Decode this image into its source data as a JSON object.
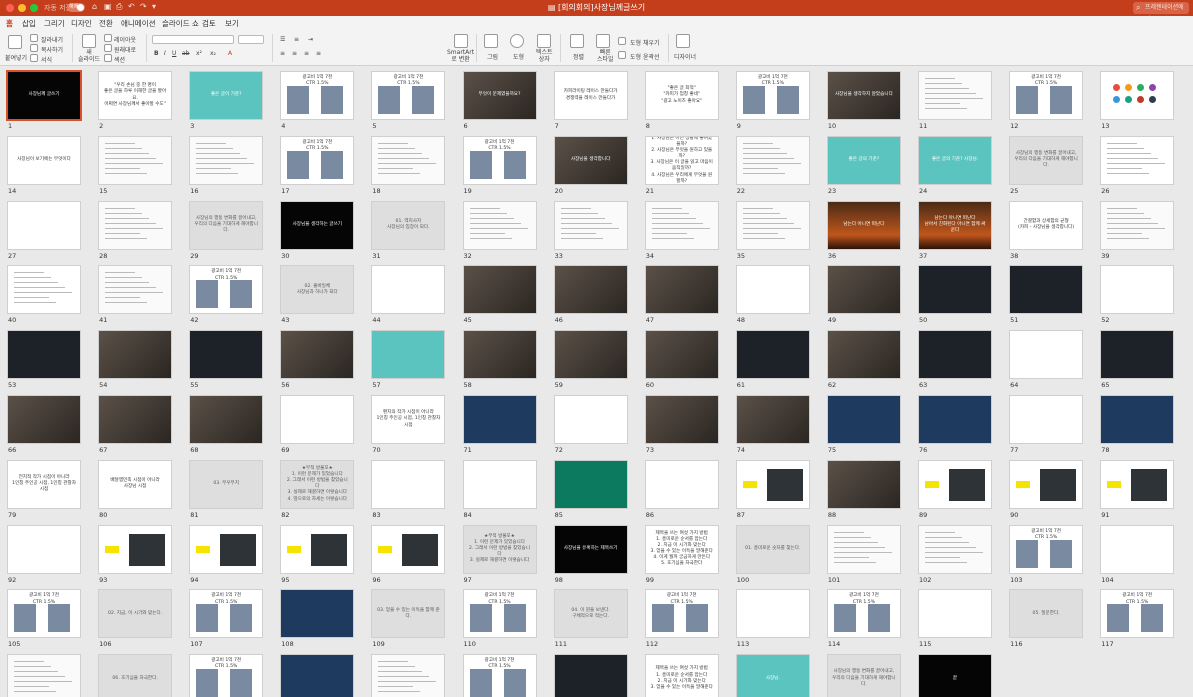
{
  "window": {
    "autosave_label": "자동 저장",
    "autosave_state": "해제",
    "title": "[회의회의]사장님께글쓰기",
    "search_placeholder": "프레젠테이션에서"
  },
  "tabs": [
    "홈",
    "삽입",
    "그리기",
    "디자인",
    "전환",
    "애니메이션",
    "슬라이드 쇼",
    "검토",
    "보기"
  ],
  "active_tab": "홈",
  "ribbon": {
    "paste": "붙여넣기",
    "cut": "잘라내기",
    "copy": "복사하기",
    "format": "서식",
    "new_slide": "새\n슬라이드",
    "layout": "레이아웃",
    "reset": "원래대로",
    "section": "섹션",
    "smartart": "SmartArt\n로 변환",
    "picture": "그림",
    "shape": "도형",
    "textbox": "텍스트\n상자",
    "arrange": "정렬",
    "quick_styles": "빠른\n스타일",
    "shape_fill": "도형 채우기",
    "shape_outline": "도형 윤곽선",
    "designer": "디자이너"
  },
  "colors": {
    "brand": "#c43e1c",
    "selection": "#d9502c",
    "teal": "#5cc4be"
  },
  "slides": [
    {
      "n": "1",
      "style": "black",
      "text": "사장님께 글쓰기",
      "selected": true
    },
    {
      "n": "2",
      "style": "white",
      "text": "\"우리 손님 중 한 명이\n좋은 글을 하루 이해한 글을 봤어요.\n어쩌면 사장님께서 좋아할 수도\""
    },
    {
      "n": "3",
      "style": "teal",
      "text": "좋은 글이 기준?"
    },
    {
      "n": "4",
      "style": "stats",
      "text": "광고비 1억 7천\nCTR 1.5%"
    },
    {
      "n": "5",
      "style": "stats",
      "text": "광고비 1억 7천\nCTR 1.5%"
    },
    {
      "n": "6",
      "style": "photo",
      "text": "무엇이 문제였을까요?"
    },
    {
      "n": "7",
      "style": "white",
      "text": "카피라이팅 레이스 만들다가\n경쟁력을 레이스 만들다가"
    },
    {
      "n": "8",
      "style": "white",
      "text": "\"좋은 글 최적\"\n\"카피가 엄청 좋네\"\n\"광고 노이즈 좋아요\""
    },
    {
      "n": "9",
      "style": "stats",
      "text": "광고비 1억 7천\nCTR 1.5%"
    },
    {
      "n": "10",
      "style": "photo",
      "text": "사장님을 생각하지 않았습니다"
    },
    {
      "n": "11",
      "style": "screen",
      "text": ""
    },
    {
      "n": "12",
      "style": "stats",
      "text": "광고비 1억 7천\nCTR 1.5%"
    },
    {
      "n": "13",
      "style": "icons",
      "text": ""
    },
    {
      "n": "14",
      "style": "white",
      "text": "사장님이 보기에는 무엇이다"
    },
    {
      "n": "15",
      "style": "screen",
      "text": ""
    },
    {
      "n": "16",
      "style": "screen",
      "text": ""
    },
    {
      "n": "17",
      "style": "stats",
      "text": "광고비 1억 7천\nCTR 1.5%"
    },
    {
      "n": "18",
      "style": "screen",
      "text": ""
    },
    {
      "n": "19",
      "style": "stats",
      "text": "광고비 1억 7천\nCTR 1.5%"
    },
    {
      "n": "20",
      "style": "photo",
      "text": "사장님을 생각합니다"
    },
    {
      "n": "21",
      "style": "white",
      "text": "1. 사장님은 어떤 상황에 놓여있을까?\n2. 사장님은 무엇을 원하고 있을까?\n3. 사장님은 이 글을 읽고 마음이 움직일까?\n4. 사장님은 우리에게 무엇을 원할까?"
    },
    {
      "n": "22",
      "style": "screen",
      "text": ""
    },
    {
      "n": "23",
      "style": "teal",
      "text": "좋은 글의 기준?"
    },
    {
      "n": "24",
      "style": "teal",
      "text": "좋은 글의 기준? 사장님."
    },
    {
      "n": "25",
      "style": "gray",
      "text": "사장님의 행동 변화를 끌어내고,\n우리의 다음을 기대하게 해야합니다."
    },
    {
      "n": "26",
      "style": "table",
      "text": ""
    },
    {
      "n": "27",
      "style": "white",
      "text": ""
    },
    {
      "n": "28",
      "style": "screen",
      "text": ""
    },
    {
      "n": "29",
      "style": "gray",
      "text": "사장님의 행동 변화를 끌어내고,\n우리의 다음을 기대하게 해야합니다."
    },
    {
      "n": "30",
      "style": "black",
      "text": "사장님을 생각하는 글쓰기"
    },
    {
      "n": "31",
      "style": "gray",
      "text": "01. 역지사지\n사장님의 입장이 되다."
    },
    {
      "n": "32",
      "style": "screen",
      "text": ""
    },
    {
      "n": "33",
      "style": "screen",
      "text": ""
    },
    {
      "n": "34",
      "style": "screen",
      "text": ""
    },
    {
      "n": "35",
      "style": "screen",
      "text": ""
    },
    {
      "n": "36",
      "style": "fire",
      "text": "남는다 아니면 떠난다"
    },
    {
      "n": "37",
      "style": "fire",
      "text": "남는다 아니면 떠난다\n남아서 친화된다 아니면 함께 싸운다"
    },
    {
      "n": "38",
      "style": "white",
      "text": "간결함과 상세함의 균형\n(카피 - 사장님을 생각합니다)"
    },
    {
      "n": "39",
      "style": "screen",
      "text": ""
    },
    {
      "n": "40",
      "style": "cols",
      "text": ""
    },
    {
      "n": "41",
      "style": "screen",
      "text": ""
    },
    {
      "n": "42",
      "style": "stats",
      "text": "광고비 1억 7천\nCTR 1.5%"
    },
    {
      "n": "43",
      "style": "gray",
      "text": "02. 몰바일체\n사장님과 하나가 되다"
    },
    {
      "n": "44",
      "style": "white",
      "text": ""
    },
    {
      "n": "45",
      "style": "photo",
      "text": ""
    },
    {
      "n": "46",
      "style": "photo",
      "text": ""
    },
    {
      "n": "47",
      "style": "photo",
      "text": ""
    },
    {
      "n": "48",
      "style": "white",
      "text": ""
    },
    {
      "n": "49",
      "style": "photo",
      "text": ""
    },
    {
      "n": "50",
      "style": "dark",
      "text": ""
    },
    {
      "n": "51",
      "style": "dark",
      "text": ""
    },
    {
      "n": "52",
      "style": "white",
      "text": ""
    },
    {
      "n": "53",
      "style": "dark",
      "text": ""
    },
    {
      "n": "54",
      "style": "photo",
      "text": ""
    },
    {
      "n": "55",
      "style": "dark",
      "text": ""
    },
    {
      "n": "56",
      "style": "photo",
      "text": ""
    },
    {
      "n": "57",
      "style": "teal",
      "text": ""
    },
    {
      "n": "58",
      "style": "photo",
      "text": ""
    },
    {
      "n": "59",
      "style": "photo",
      "text": ""
    },
    {
      "n": "60",
      "style": "photo",
      "text": ""
    },
    {
      "n": "61",
      "style": "dark",
      "text": ""
    },
    {
      "n": "62",
      "style": "photo",
      "text": ""
    },
    {
      "n": "63",
      "style": "dark",
      "text": ""
    },
    {
      "n": "64",
      "style": "white",
      "text": ""
    },
    {
      "n": "65",
      "style": "dark",
      "text": ""
    },
    {
      "n": "66",
      "style": "photo",
      "text": ""
    },
    {
      "n": "67",
      "style": "photo",
      "text": ""
    },
    {
      "n": "68",
      "style": "photo",
      "text": ""
    },
    {
      "n": "69",
      "style": "white",
      "text": ""
    },
    {
      "n": "70",
      "style": "white",
      "text": "편지의 작가 시점이 아니라\n1인칭 주인공 시점, 1인칭 관찰자 시점"
    },
    {
      "n": "71",
      "style": "navy",
      "text": ""
    },
    {
      "n": "72",
      "style": "white",
      "text": ""
    },
    {
      "n": "73",
      "style": "photo",
      "text": ""
    },
    {
      "n": "74",
      "style": "photo",
      "text": ""
    },
    {
      "n": "75",
      "style": "navy",
      "text": ""
    },
    {
      "n": "76",
      "style": "navy",
      "text": ""
    },
    {
      "n": "77",
      "style": "white",
      "text": ""
    },
    {
      "n": "78",
      "style": "navy",
      "text": ""
    },
    {
      "n": "79",
      "style": "white",
      "text": "전지적 작가 시점이 아니라\n1인칭 주인공 시점, 1인칭 관찰자 시점"
    },
    {
      "n": "80",
      "style": "white",
      "text": "배달앱민족 시점이 아니라\n사장님 시점"
    },
    {
      "n": "81",
      "style": "gray",
      "text": "03. 무우무치"
    },
    {
      "n": "82",
      "style": "gray",
      "text": "★무적 방울모★\n1. 이런 문제가 있었습니다\n2. 그래서 이런 방법을 찾았습니다\n3. 실제로 해결하면 이렇습니다\n4. 앞으로의 자세는 이렇습니다"
    },
    {
      "n": "83",
      "style": "white",
      "text": ""
    },
    {
      "n": "84",
      "style": "white",
      "text": ""
    },
    {
      "n": "85",
      "style": "green",
      "text": ""
    },
    {
      "n": "86",
      "style": "white",
      "text": ""
    },
    {
      "n": "87",
      "style": "tag",
      "text": ""
    },
    {
      "n": "88",
      "style": "photo",
      "text": ""
    },
    {
      "n": "89",
      "style": "tag",
      "text": ""
    },
    {
      "n": "90",
      "style": "tag",
      "text": ""
    },
    {
      "n": "91",
      "style": "tag",
      "text": ""
    },
    {
      "n": "92",
      "style": "white",
      "text": ""
    },
    {
      "n": "93",
      "style": "tag",
      "text": ""
    },
    {
      "n": "94",
      "style": "tag",
      "text": ""
    },
    {
      "n": "95",
      "style": "tag",
      "text": ""
    },
    {
      "n": "96",
      "style": "tag",
      "text": ""
    },
    {
      "n": "97",
      "style": "gray",
      "text": "★무적 방울모★\n1. 이런 문제가 있었습니다\n2. 그래서 이런 방법을 찾았습니다\n3. 실제로 해결하면 이렇습니다"
    },
    {
      "n": "98",
      "style": "black",
      "text": "사장님을 유혹하는 제목쓰기"
    },
    {
      "n": "99",
      "style": "white",
      "text": "제목을 쓰는 여섯 가지 방법\n1. 흥미로운 순서를 잡는다\n2. 지금 이 시기와 맞는다\n3. 얻을 수 있는 이득을 말해준다\n4. 이게 뭘까 궁금하게 만든다\n5. 호기심을 자극한다"
    },
    {
      "n": "100",
      "style": "gray",
      "text": "01. 흥미로운 숫자를 찾는다."
    },
    {
      "n": "101",
      "style": "screen",
      "text": ""
    },
    {
      "n": "102",
      "style": "screen",
      "text": ""
    },
    {
      "n": "103",
      "style": "stats",
      "text": "광고비 1억 7천\nCTR 1.5%"
    },
    {
      "n": "104",
      "style": "white",
      "text": ""
    },
    {
      "n": "105",
      "style": "stats",
      "text": "광고비 1억 7천\nCTR 1.5%"
    },
    {
      "n": "106",
      "style": "gray",
      "text": "02. 지금, 이 시기와 맞는다."
    },
    {
      "n": "107",
      "style": "stats",
      "text": "광고비 1억 7천\nCTR 1.5%"
    },
    {
      "n": "108",
      "style": "navy",
      "text": ""
    },
    {
      "n": "109",
      "style": "gray",
      "text": "03. 얻을 수 있는 이득을 함께 준다."
    },
    {
      "n": "110",
      "style": "stats",
      "text": "광고비 1억 7천\nCTR 1.5%"
    },
    {
      "n": "111",
      "style": "gray",
      "text": "04. 이 뭔을 보낸다.\n구체적으로 적는다."
    },
    {
      "n": "112",
      "style": "stats",
      "text": "광고비 1억 7천\nCTR 1.5%"
    },
    {
      "n": "113",
      "style": "white",
      "text": ""
    },
    {
      "n": "114",
      "style": "stats",
      "text": "광고비 1억 7천\nCTR 1.5%"
    },
    {
      "n": "115",
      "style": "white",
      "text": ""
    },
    {
      "n": "116",
      "style": "gray",
      "text": "05. 질문한다."
    },
    {
      "n": "117",
      "style": "stats",
      "text": "광고비 1억 7천\nCTR 1.5%"
    },
    {
      "n": "118",
      "style": "screen",
      "text": ""
    },
    {
      "n": "119",
      "style": "gray",
      "text": "06. 호기심을 자극한다."
    },
    {
      "n": "120",
      "style": "stats",
      "text": "광고비 1억 7천\nCTR 1.5%"
    },
    {
      "n": "121",
      "style": "navy",
      "text": ""
    },
    {
      "n": "122",
      "style": "screen",
      "text": ""
    },
    {
      "n": "123",
      "style": "stats",
      "text": "광고비 1억 7천\nCTR 1.5%"
    },
    {
      "n": "124",
      "style": "dark",
      "text": ""
    },
    {
      "n": "125",
      "style": "white",
      "text": "제목을 쓰는 여섯 가지 방법\n1. 흥미로운 순서를 잡는다\n2. 지금 이 시기와 맞는다\n3. 얻을 수 있는 이득을 말해준다"
    },
    {
      "n": "126",
      "style": "teal",
      "text": "사장님."
    },
    {
      "n": "127",
      "style": "gray",
      "text": "사장님의 행동 변화를 끌어내고,\n우리의 다음을 기대하게 해야합니다."
    },
    {
      "n": "128",
      "style": "black",
      "text": "끝"
    }
  ]
}
